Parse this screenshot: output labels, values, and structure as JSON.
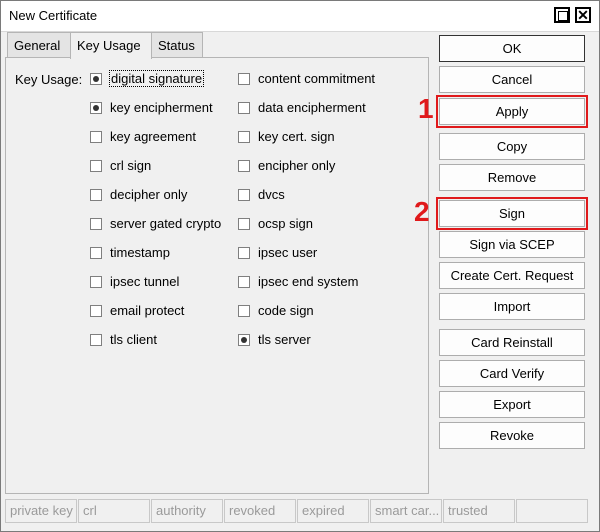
{
  "window": {
    "title": "New Certificate"
  },
  "tabs": [
    {
      "label": "General"
    },
    {
      "label": "Key Usage"
    },
    {
      "label": "Status"
    }
  ],
  "key_usage": {
    "label": "Key Usage:",
    "left": [
      {
        "label": "digital signature",
        "checked": true
      },
      {
        "label": "key encipherment",
        "checked": true
      },
      {
        "label": "key agreement",
        "checked": false
      },
      {
        "label": "crl sign",
        "checked": false
      },
      {
        "label": "decipher only",
        "checked": false
      },
      {
        "label": "server gated crypto",
        "checked": false
      },
      {
        "label": "timestamp",
        "checked": false
      },
      {
        "label": "ipsec tunnel",
        "checked": false
      },
      {
        "label": "email protect",
        "checked": false
      },
      {
        "label": "tls client",
        "checked": false
      }
    ],
    "right": [
      {
        "label": "content commitment",
        "checked": false
      },
      {
        "label": "data encipherment",
        "checked": false
      },
      {
        "label": "key cert. sign",
        "checked": false
      },
      {
        "label": "encipher only",
        "checked": false
      },
      {
        "label": "dvcs",
        "checked": false
      },
      {
        "label": "ocsp sign",
        "checked": false
      },
      {
        "label": "ipsec user",
        "checked": false
      },
      {
        "label": "ipsec end system",
        "checked": false
      },
      {
        "label": "code sign",
        "checked": false
      },
      {
        "label": "tls server",
        "checked": true
      }
    ]
  },
  "buttons": {
    "ok": "OK",
    "cancel": "Cancel",
    "apply": "Apply",
    "copy": "Copy",
    "remove": "Remove",
    "sign": "Sign",
    "sign_scep": "Sign via SCEP",
    "create_request": "Create Cert. Request",
    "import": "Import",
    "card_reinstall": "Card Reinstall",
    "card_verify": "Card Verify",
    "export": "Export",
    "revoke": "Revoke"
  },
  "annotations": {
    "step1": "1",
    "step2": "2",
    "color": "#e0191b"
  },
  "status_bar": [
    "private key",
    "crl",
    "authority",
    "revoked",
    "expired",
    "smart car...",
    "trusted",
    ""
  ]
}
